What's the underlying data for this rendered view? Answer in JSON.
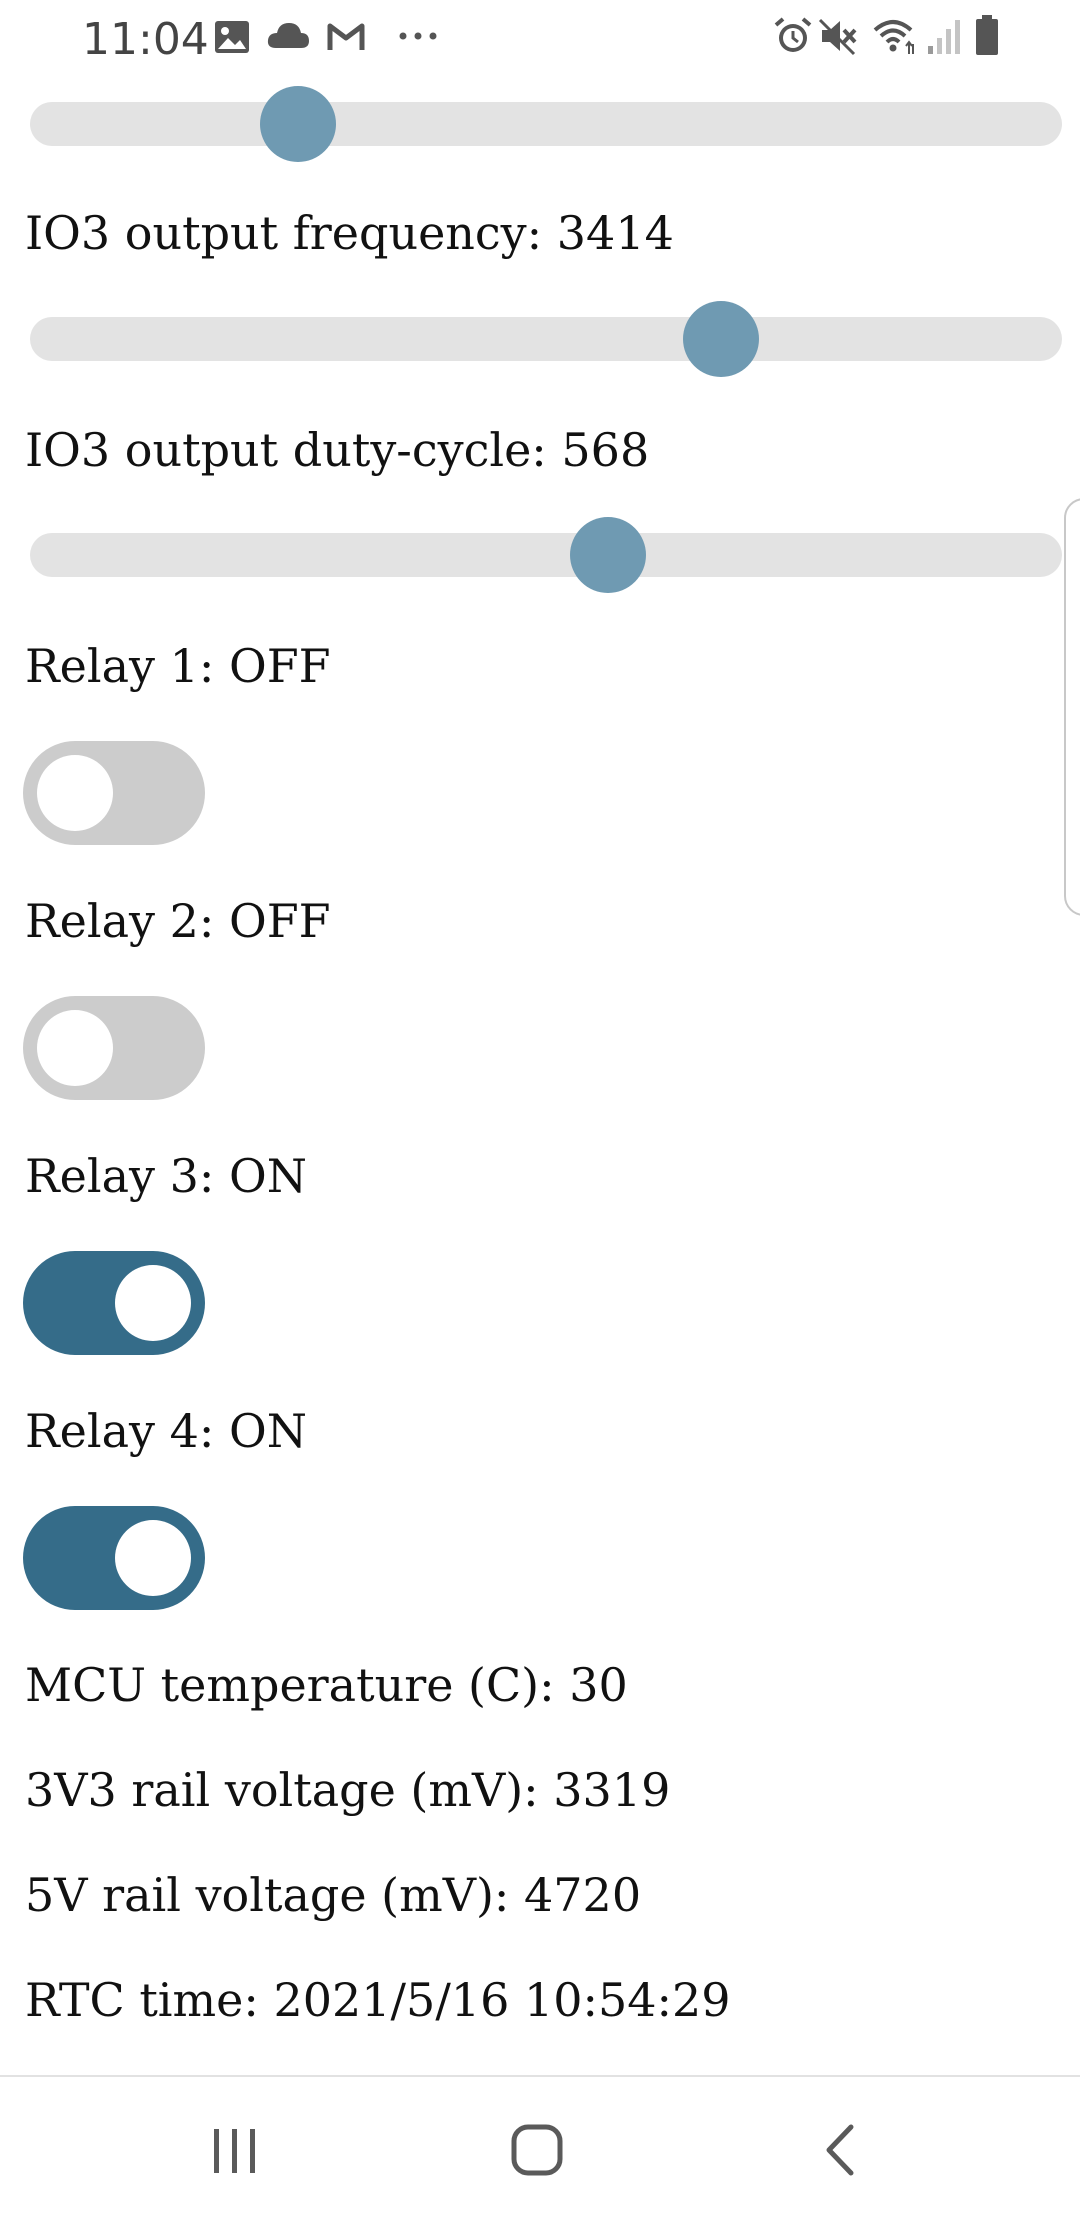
{
  "status_bar": {
    "time": "11:04",
    "left_icons": [
      "image-icon",
      "cloud-icon",
      "gmail-icon",
      "more-dots-icon"
    ],
    "right_icons": [
      "alarm-icon",
      "mute-icon",
      "wifi-icon",
      "signal-icon",
      "battery-icon"
    ]
  },
  "sliders": [
    {
      "name": "top",
      "value_fraction": 0.26
    },
    {
      "name": "io3-frequency",
      "value_fraction": 0.67
    },
    {
      "name": "io3-duty-cycle",
      "value_fraction": 0.56
    }
  ],
  "labels": {
    "io3_frequency": "IO3 output frequency: 3414",
    "io3_duty_cycle": "IO3 output duty-cycle: 568"
  },
  "relays": [
    {
      "label": "Relay 1: OFF",
      "on": false
    },
    {
      "label": "Relay 2: OFF",
      "on": false
    },
    {
      "label": "Relay 3: ON",
      "on": true
    },
    {
      "label": "Relay 4: ON",
      "on": true
    }
  ],
  "readings": {
    "mcu_temperature": "MCU temperature (C): 30",
    "rail_3v3": "3V3 rail voltage (mV): 3319",
    "rail_5v": "5V rail voltage (mV): 4720",
    "rtc_time": "RTC time: 2021/5/16 10:54:29"
  },
  "colors": {
    "slider_thumb": "#6f9ab2",
    "slider_track": "#e3e3e3",
    "toggle_on": "#356c89",
    "toggle_off": "#cccccc"
  },
  "nav_bar": {
    "buttons": [
      "recent-apps-icon",
      "home-icon",
      "back-icon"
    ]
  }
}
